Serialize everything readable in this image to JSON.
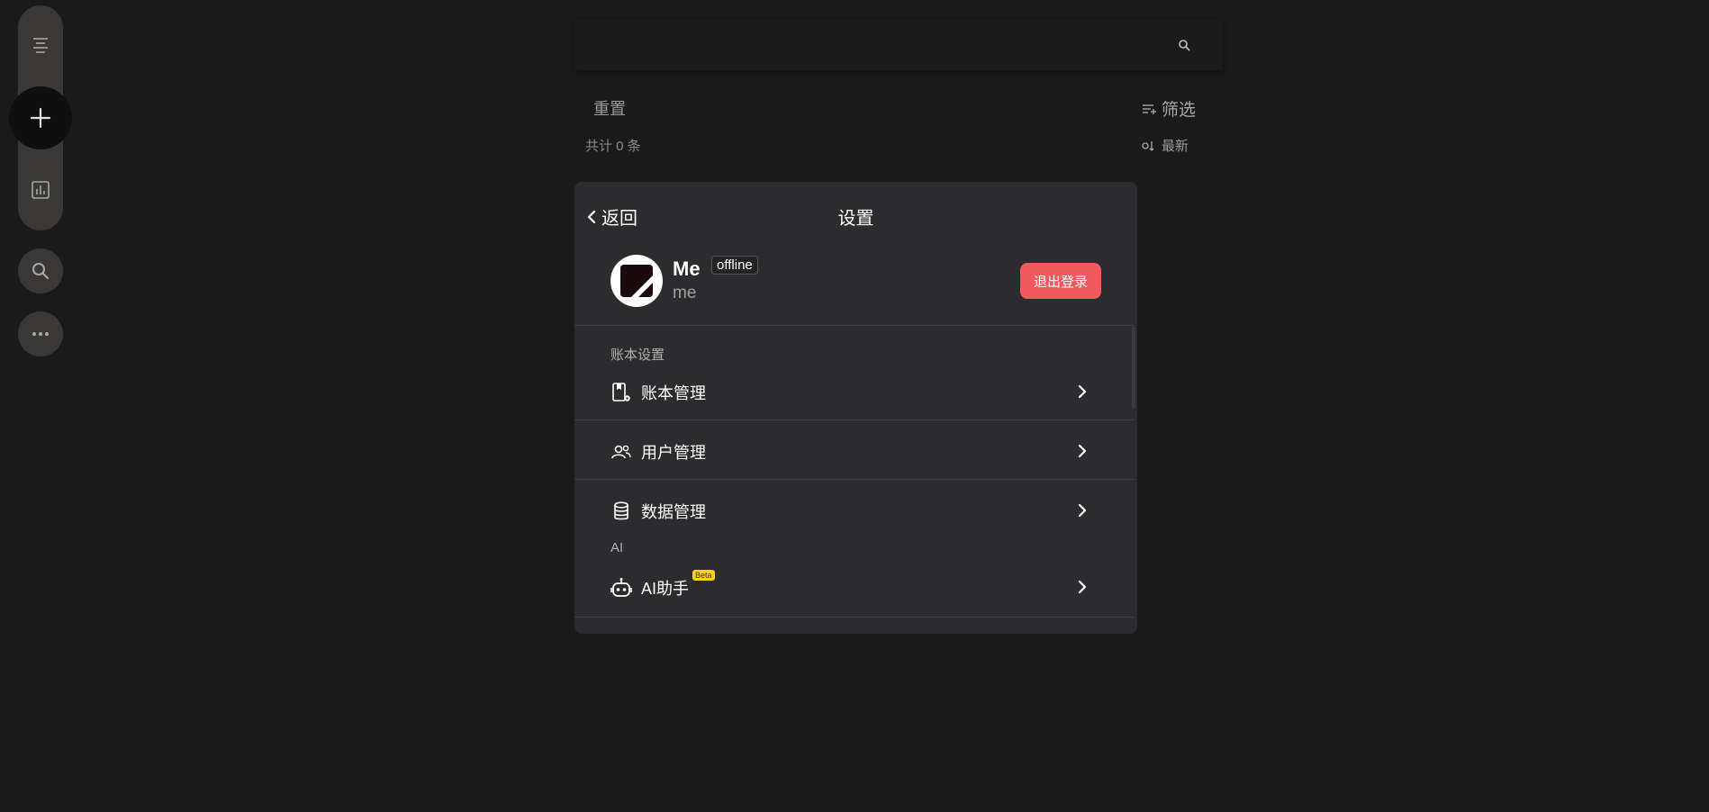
{
  "top": {
    "reset_label": "重置",
    "count_label": "共计 0 条",
    "filter_label": "筛选",
    "sort_label": "最新"
  },
  "settings": {
    "back_label": "返回",
    "title": "设置",
    "user": {
      "name": "Me",
      "status": "offline",
      "id": "me"
    },
    "logout_label": "退出登录",
    "sections": {
      "account_label": "账本设置",
      "ai_label": "AI"
    },
    "items": [
      {
        "label": "账本管理",
        "icon": "book-gear-icon"
      },
      {
        "label": "用户管理",
        "icon": "users-icon"
      },
      {
        "label": "数据管理",
        "icon": "database-icon"
      },
      {
        "label": "AI助手",
        "icon": "robot-icon",
        "badge": "Beta"
      }
    ]
  },
  "colors": {
    "background": "#1a1a1a",
    "panel": "#2c2c2e",
    "logout": "#f05a5f",
    "beta": "#ffd21a"
  }
}
